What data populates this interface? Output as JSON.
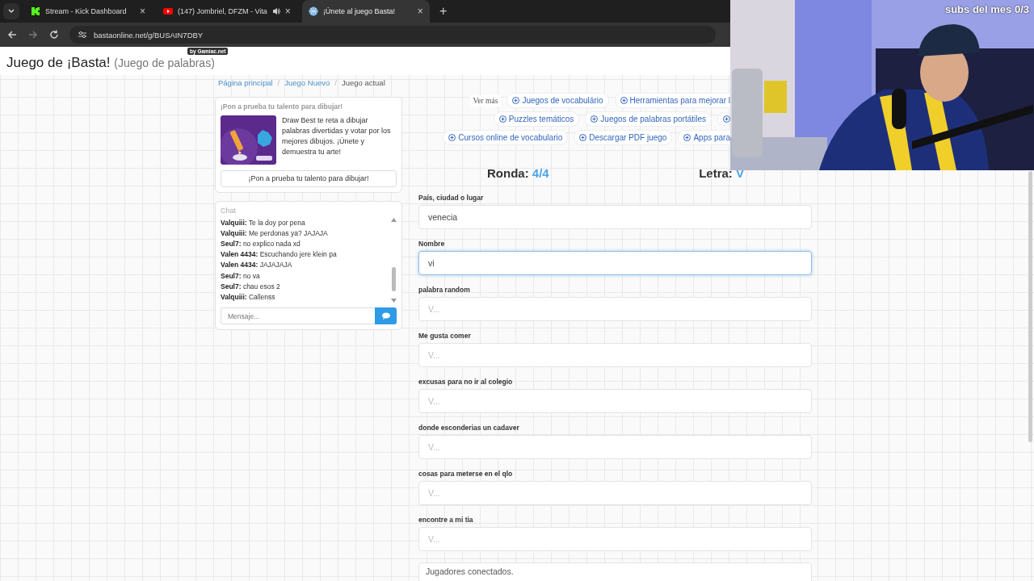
{
  "browser": {
    "tabs": [
      {
        "title": "Stream - Kick Dashboard",
        "selected": false,
        "kind": "kick",
        "audio": false
      },
      {
        "title": "(147) Jombriel, DFZM - Vita",
        "selected": false,
        "kind": "video",
        "audio": true
      },
      {
        "title": "¡Únete al juego Basta!",
        "selected": true,
        "kind": "globe",
        "audio": false
      }
    ],
    "close": "×",
    "new_tab": "+",
    "url": "bastaonline.net/g/BUSAIN7DBY"
  },
  "overlay": {
    "kind": "picture",
    "caption": "subs del mes 0/3"
  },
  "page": {
    "badge": "by Gamiac.net",
    "title": "Juego de ¡Basta!",
    "subtitle": "(Juego de palabras)"
  },
  "breadcrumb_separator": "/",
  "breadcrumb": [
    {
      "label": "Página principal",
      "kind": "link"
    },
    {
      "label": "Juego Nuevo",
      "kind": "link"
    },
    {
      "label": "Juego actual",
      "kind": "current"
    }
  ],
  "promo": {
    "heading": "¡Pon a prueba tu talento para dibujar!",
    "description": "Draw Best te reta a dibujar palabras divertidas y votar por los mejores dibujos. ¡Únete y demuestra tu arte!",
    "button": "¡Pon a prueba tu talento para dibujar!"
  },
  "chat": {
    "title": "Chat",
    "messages": [
      {
        "author": "Valquiii:",
        "text": "Te la doy por pena"
      },
      {
        "author": "Valquiii:",
        "text": "Me perdonas ya? JAJAJA"
      },
      {
        "author": "Seul7:",
        "text": "no explico nada xd"
      },
      {
        "author": "Valen 4434:",
        "text": "Escuchando jere klein pa"
      },
      {
        "author": "Valen 4434:",
        "text": "JAJAJAJA"
      },
      {
        "author": "Seul7:",
        "text": "no va"
      },
      {
        "author": "Seul7:",
        "text": "chau esos 2"
      },
      {
        "author": "Valquiii:",
        "text": "Callenss"
      }
    ],
    "placeholder": "Mensaje..."
  },
  "more": {
    "label": "Ver más",
    "rows": [
      [
        {
          "kind": "link",
          "label": "Juegos de vocabulário"
        },
        {
          "kind": "cut",
          "label": "Herramientas para mejorar l"
        }
      ],
      [
        {
          "kind": "link",
          "label": "Puzzles temáticos"
        },
        {
          "kind": "link",
          "label": "Juegos de palabras portátiles"
        },
        {
          "kind": "icon"
        }
      ],
      [
        {
          "kind": "link",
          "label": "Cursos online de vocabulario"
        },
        {
          "kind": "link",
          "label": "Descargar PDF juego"
        },
        {
          "kind": "cut",
          "label": "Apps para"
        }
      ]
    ]
  },
  "round": {
    "label": "Ronda:",
    "value": "4/4"
  },
  "letter": {
    "label": "Letra:",
    "value": "V"
  },
  "fields": [
    {
      "label": "País, ciudad o lugar",
      "value": "venecia",
      "focused": false
    },
    {
      "label": "Nombre",
      "value": "vi",
      "focused": true
    },
    {
      "label": "palabra random",
      "placeholder": "V...",
      "focused": false
    },
    {
      "label": "Me gusta comer",
      "placeholder": "V...",
      "focused": false
    },
    {
      "label": "excusas para no ir al colegio",
      "placeholder": "V...",
      "focused": false
    },
    {
      "label": "donde esconderias un cadaver",
      "placeholder": "V...",
      "focused": false
    },
    {
      "label": "cosas para meterse en el qlo",
      "placeholder": "V...",
      "focused": false
    },
    {
      "label": "encontre a mi tia",
      "placeholder": "V...",
      "focused": false
    }
  ],
  "players": {
    "title": "Jugadores conectados."
  }
}
